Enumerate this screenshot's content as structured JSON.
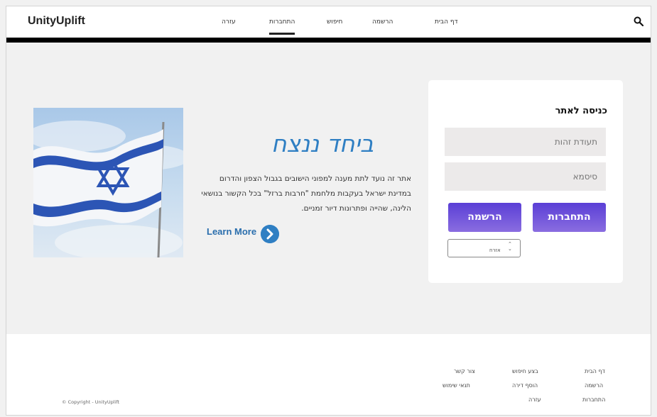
{
  "header": {
    "brand": "UnityUplift",
    "nav": [
      {
        "label": "דף הבית"
      },
      {
        "label": "הרשמה"
      },
      {
        "label": "חיפוש"
      },
      {
        "label": "התחברות"
      },
      {
        "label": "עזרה"
      }
    ],
    "search_icon": "search-icon"
  },
  "hero": {
    "slogan": "ביחד ננצח",
    "description": "אתר זה נועד לתת מענה למפוני הישובים בגבול הצפון והדרום במדינת ישראל בעקבות מלחמת \"חרבות ברזל\" בכל הקשור בנושאי הלינה, שהייה ופתרונות דיור זמניים.",
    "learn_more": "Learn More",
    "learn_more_icon": "chevron-right-circle-icon",
    "image": "israel-flag-image"
  },
  "login": {
    "title": "כניסה לאתר",
    "id_placeholder": "תעודת זהות",
    "password_placeholder": "סיסמא",
    "login_button": "התחברות",
    "register_button": "הרשמה",
    "select_value": "אזרח",
    "accent_color": "#6a4fd8"
  },
  "footer": {
    "col1": [
      "דף הבית",
      "הרשמה",
      "התחברות"
    ],
    "col2": [
      "בצע חיפוש",
      "הוסף דירה",
      "עזרה"
    ],
    "col3": [
      "צור קשר",
      "תנאי שימוש"
    ],
    "copyright": "© Copyright - UnityUplift"
  }
}
